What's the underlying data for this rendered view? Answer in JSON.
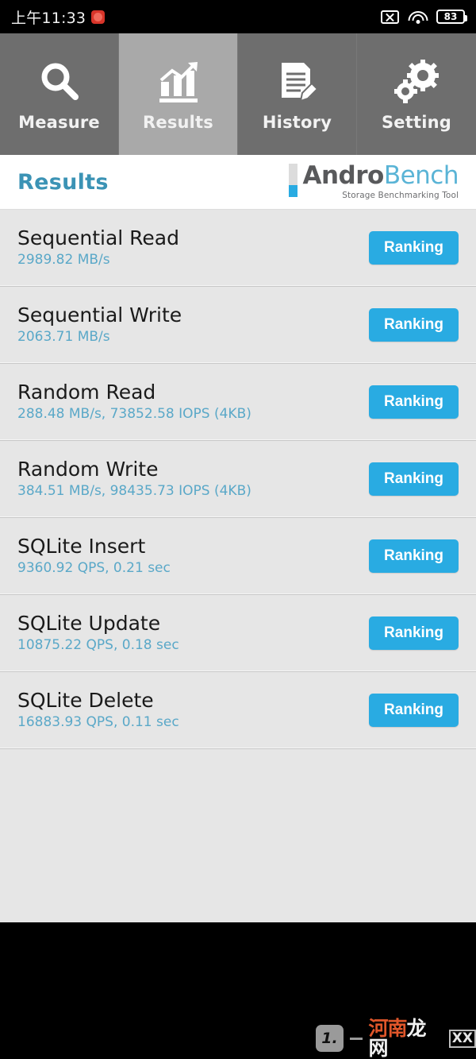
{
  "statusbar": {
    "clock": "上午11:33",
    "notification_icon": "app-notification-icon",
    "nosim_icon": "no-sim-icon",
    "wifi_icon": "wifi-icon",
    "battery_icon": "battery-icon",
    "battery_level": "83"
  },
  "tabs": [
    {
      "label": "Measure",
      "icon": "magnifier-icon",
      "active": false
    },
    {
      "label": "Results",
      "icon": "bar-chart-icon",
      "active": true
    },
    {
      "label": "History",
      "icon": "document-pencil-icon",
      "active": false
    },
    {
      "label": "Setting",
      "icon": "gears-icon",
      "active": false
    }
  ],
  "header": {
    "title": "Results",
    "logo_andro": "Andro",
    "logo_bench": "Bench",
    "logo_subtitle": "Storage Benchmarking Tool"
  },
  "results": {
    "ranking_label": "Ranking",
    "rows": [
      {
        "title": "Sequential Read",
        "value": "2989.82 MB/s"
      },
      {
        "title": "Sequential Write",
        "value": "2063.71 MB/s"
      },
      {
        "title": "Random Read",
        "value": "288.48 MB/s, 73852.58 IOPS (4KB)"
      },
      {
        "title": "Random Write",
        "value": "384.51 MB/s, 98435.73 IOPS (4KB)"
      },
      {
        "title": "SQLite Insert",
        "value": "9360.92 QPS, 0.21 sec"
      },
      {
        "title": "SQLite Update",
        "value": "10875.22 QPS, 0.18 sec"
      },
      {
        "title": "SQLite Delete",
        "value": "16883.93 QPS, 0.11 sec"
      }
    ]
  },
  "watermark": {
    "badge": "1.",
    "cn_first": "河南",
    "cn_second": "龙网",
    "suffix": "XX"
  },
  "colors": {
    "accent_blue": "#29abe2",
    "title_blue": "#3b93b5",
    "value_blue": "#5aa8c8",
    "tab_bg": "#6e6e6e",
    "tab_active_bg": "#a9a9a9",
    "list_bg": "#e6e6e6"
  }
}
